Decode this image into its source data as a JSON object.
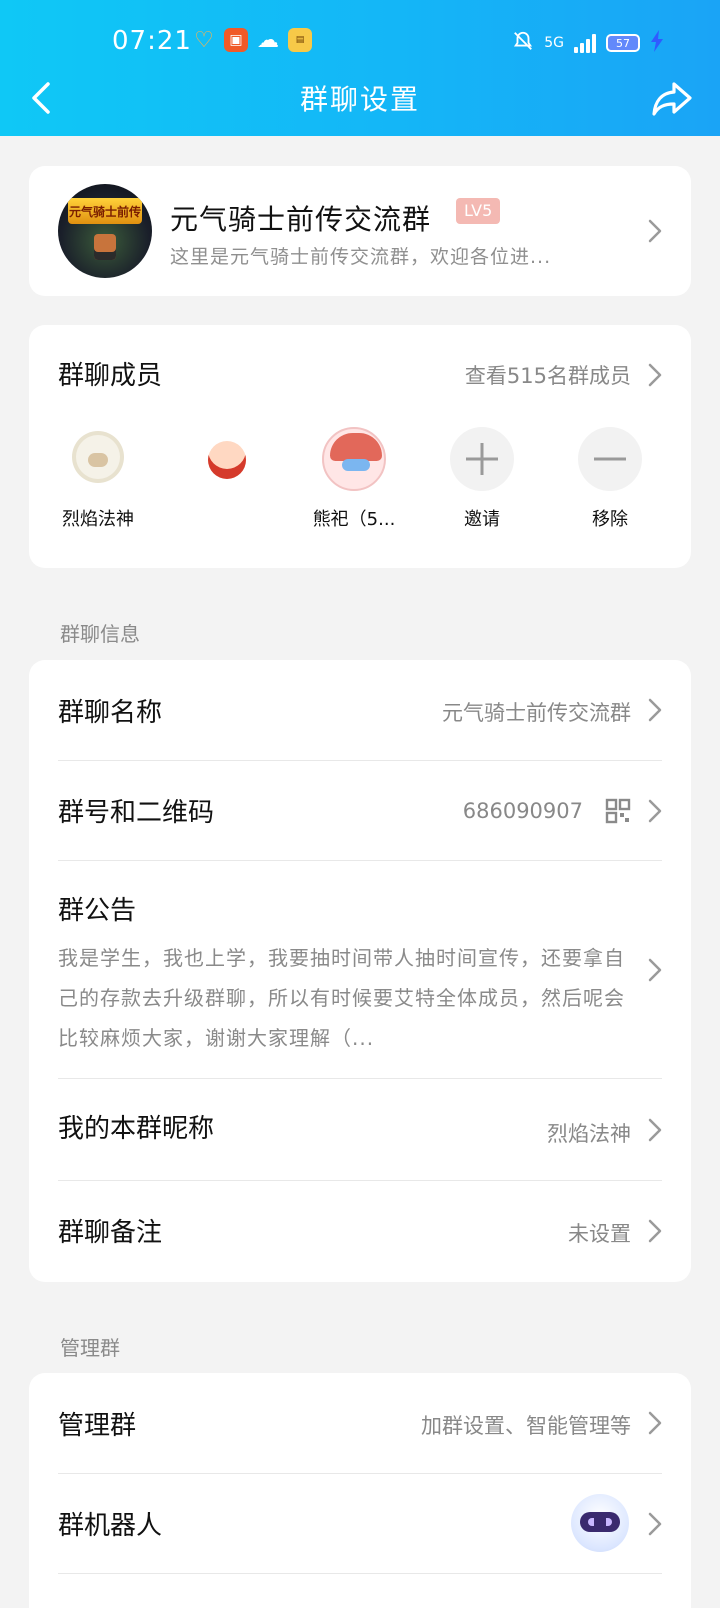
{
  "status_bar": {
    "time": "07:21",
    "network": "5G",
    "battery": "57"
  },
  "nav": {
    "title": "群聊设置"
  },
  "group": {
    "name": "元气骑士前传交流群",
    "level": "LV5",
    "description": "这里是元气骑士前传交流群，欢迎各位进...",
    "avatar_text": "元气骑士前传"
  },
  "members": {
    "title": "群聊成员",
    "view_all": "查看515名群成员",
    "list": [
      {
        "name": "烈焰法神"
      },
      {
        "name": ""
      },
      {
        "name": "熊祀（5..."
      }
    ],
    "invite_label": "邀请",
    "remove_label": "移除"
  },
  "info_section": {
    "label": "群聊信息",
    "group_name_title": "群聊名称",
    "group_name_value": "元气骑士前传交流群",
    "group_id_title": "群号和二维码",
    "group_id_value": "686090907",
    "announcement_title": "群公告",
    "announcement_text": "我是学生，我也上学，我要抽时间带人抽时间宣传，还要拿自己的存款去升级群聊，所以有时候要艾特全体成员，然后呢会比较麻烦大家，谢谢大家理解（...",
    "nickname_title": "我的本群昵称",
    "nickname_value": "烈焰法神",
    "remark_title": "群聊备注",
    "remark_value": "未设置"
  },
  "manage_section": {
    "label": "管理群",
    "manage_title": "管理群",
    "manage_value": "加群设置、智能管理等",
    "robot_title": "群机器人"
  },
  "colors": {
    "header_start": "#0fc8f6",
    "header_end": "#1aa4f6",
    "background": "#f3f3f3",
    "level_badge": "#f4b9b3"
  }
}
